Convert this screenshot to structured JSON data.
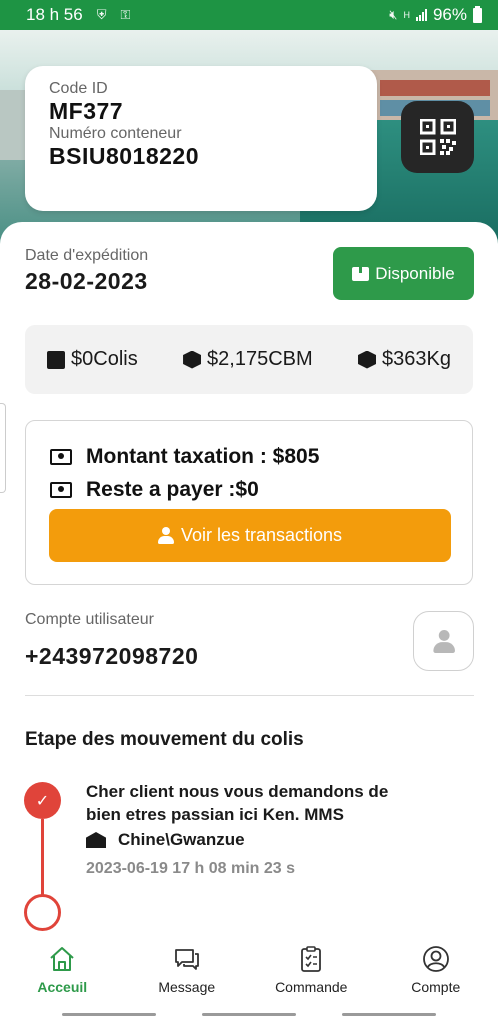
{
  "status_bar": {
    "time": "18 h 56",
    "battery": "96%"
  },
  "shipment": {
    "code_label": "Code ID",
    "code_value": "MF377",
    "container_label": "Numéro conteneur",
    "container_value": "BSIU8018220",
    "expedition_label": "Date d'expédition",
    "expedition_date": "28-02-2023",
    "status_label": "Disponible"
  },
  "stats": {
    "colis": "$0Colis",
    "cbm": "$2,175CBM",
    "weight": "$363Kg"
  },
  "taxation": {
    "montant": "Montant taxation : $805",
    "reste": "Reste a payer :$0",
    "button_label": "Voir les transactions"
  },
  "account": {
    "label": "Compte utilisateur",
    "phone": "+243972098720"
  },
  "steps": {
    "title": "Etape des mouvement du colis",
    "items": [
      {
        "message": "Cher client nous vous demandons de bien etres passian ici Ken.  MMS",
        "place": "Chine\\Gwanzue",
        "time": "2023-06-19 17 h 08 min 23 s"
      }
    ]
  },
  "nav": {
    "items": [
      {
        "label": "Acceuil",
        "icon": "home-icon",
        "active": true
      },
      {
        "label": "Message",
        "icon": "chat-icon",
        "active": false
      },
      {
        "label": "Commande",
        "icon": "clipboard-icon",
        "active": false
      },
      {
        "label": "Compte",
        "icon": "user-circle-icon",
        "active": false
      }
    ]
  },
  "colors": {
    "brand_green": "#2e9a4a",
    "status_green": "#1e9444",
    "orange": "#f39c0c",
    "red": "#e0443a"
  }
}
